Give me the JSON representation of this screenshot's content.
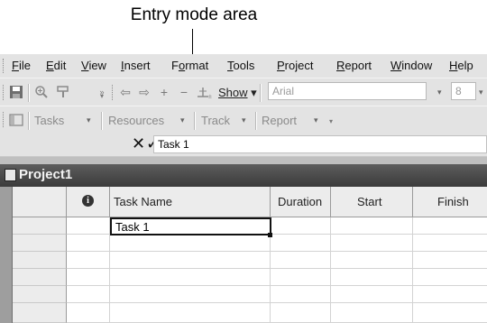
{
  "callout": {
    "text": "Entry mode area"
  },
  "menu": {
    "items": [
      {
        "prefix": "",
        "ul": "F",
        "rest": "ile"
      },
      {
        "prefix": "",
        "ul": "E",
        "rest": "dit"
      },
      {
        "prefix": "",
        "ul": "V",
        "rest": "iew"
      },
      {
        "prefix": "",
        "ul": "I",
        "rest": "nsert"
      },
      {
        "prefix": "F",
        "ul": "o",
        "rest": "rmat"
      },
      {
        "prefix": "",
        "ul": "T",
        "rest": "ools"
      },
      {
        "prefix": "",
        "ul": "P",
        "rest": "roject"
      },
      {
        "prefix": "",
        "ul": "R",
        "rest": "eport"
      },
      {
        "prefix": "",
        "ul": "W",
        "rest": "indow"
      },
      {
        "prefix": "",
        "ul": "H",
        "rest": "elp"
      }
    ]
  },
  "toolbar1": {
    "show_label": "Show",
    "font_value": "Arial",
    "size_value": "8"
  },
  "toolbar2": {
    "tasks": "Tasks",
    "resources": "Resources",
    "track": "Track",
    "report": "Report"
  },
  "entry": {
    "value": "Task 1",
    "cancel_glyph": "✕",
    "enter_glyph": "✓"
  },
  "project": {
    "title": "Project1"
  },
  "table": {
    "indicator_glyph": "i",
    "columns": [
      "Task Name",
      "Duration",
      "Start",
      "Finish"
    ],
    "rows": [
      {
        "name": "Task 1",
        "duration": "",
        "start": "",
        "finish": ""
      },
      {
        "name": "",
        "duration": "",
        "start": "",
        "finish": ""
      },
      {
        "name": "",
        "duration": "",
        "start": "",
        "finish": ""
      },
      {
        "name": "",
        "duration": "",
        "start": "",
        "finish": ""
      },
      {
        "name": "",
        "duration": "",
        "start": "",
        "finish": ""
      },
      {
        "name": "",
        "duration": "",
        "start": "",
        "finish": ""
      }
    ]
  }
}
